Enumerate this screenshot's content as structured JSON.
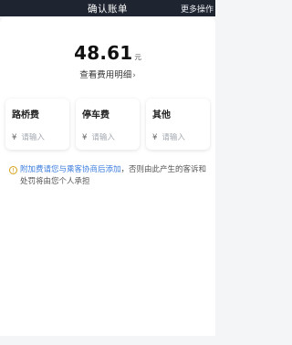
{
  "header": {
    "title": "确认账单",
    "more": "更多操作"
  },
  "fare": {
    "amount": "48.61",
    "unit": "元",
    "detail_link": "查看费用明细",
    "chevron": "›"
  },
  "fees": [
    {
      "name": "路桥费",
      "currency": "¥",
      "placeholder": "请输入"
    },
    {
      "name": "停车费",
      "currency": "¥",
      "placeholder": "请输入"
    },
    {
      "name": "其他",
      "currency": "¥",
      "placeholder": "请输入"
    }
  ],
  "notice": {
    "icon": "info-icon",
    "highlight": "附加费请您与乘客协商后添加",
    "rest": "，否则由此产生的客诉和处罚将由您个人承担"
  },
  "colors": {
    "topbar": "#1f2530",
    "accent": "#3b7ddd",
    "warn": "#d4a017"
  }
}
